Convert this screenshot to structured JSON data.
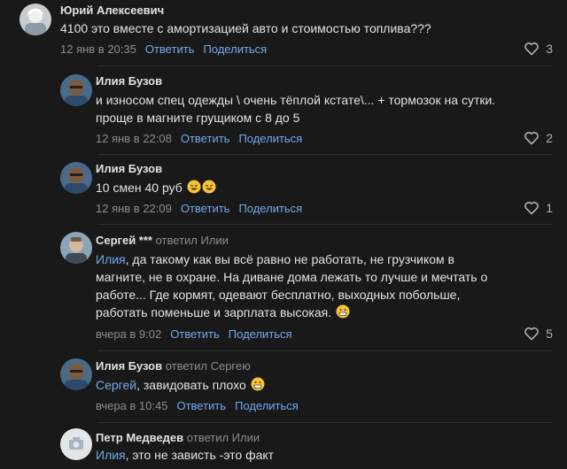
{
  "comments": [
    {
      "author": "Юрий Алексеевич",
      "replied_text": "",
      "text": "4100 это вместе с амортизацией авто и стоимостью топлива???",
      "time": "12 янв в 20:35",
      "likes": "3"
    },
    {
      "author": "Илия Бузов",
      "replied_text": "",
      "text_line1": "и износом спец одежды \\ очень тёплой кстате\\... + тормозок на сутки.",
      "text_line2": "проще в магните грущиком с 8 до 5",
      "time": "12 янв в 22:08",
      "likes": "2"
    },
    {
      "author": "Илия Бузов",
      "replied_text": "",
      "text": "10 смен 40 руб",
      "time": "12 янв в 22:09",
      "likes": "1"
    },
    {
      "author": "Сергей ***",
      "replied_text": "ответил Илии",
      "mention": "Илия",
      "text_line1": ", да такому как вы всё равно не работать, не грузчиком в",
      "text_line2": "магните, не в охране. На диване дома лежать то лучше и мечтать о",
      "text_line3": "работе... Где кормят, одевают бесплатно, выходных побольше,",
      "text_line4": "работать поменьше и зарплата высокая.",
      "time": "вчера в 9:02",
      "likes": "5"
    },
    {
      "author": "Илия Бузов",
      "replied_text": "ответил Сергею",
      "mention": "Сергей",
      "text": ", завидовать плохо",
      "time": "вчера в 10:45"
    },
    {
      "author": "Петр Медведев",
      "replied_text": "ответил Илии",
      "mention": "Илия",
      "text": ", это не зависть -это факт"
    }
  ],
  "actions": {
    "reply": "Ответить",
    "share": "Поделиться"
  },
  "colors": {
    "background": "#19191a",
    "link": "#71aaeb",
    "secondary": "#8a8d91",
    "text": "#e1e3e6"
  }
}
